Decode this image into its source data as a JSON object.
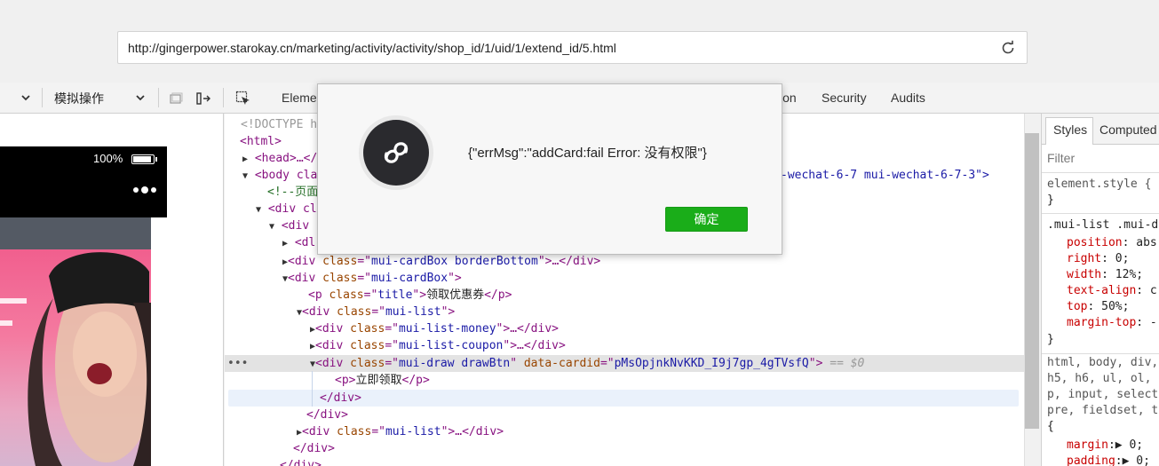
{
  "address_bar": {
    "url": "http://gingerpower.starokay.cn/marketing/activity/activity/shop_id/1/uid/1/extend_id/5.html"
  },
  "devtools": {
    "toolbar": {
      "simulate_label": "模拟操作"
    },
    "tabs": [
      {
        "label": "Eleme"
      },
      {
        "label": "ion"
      },
      {
        "label": "Security"
      },
      {
        "label": "Audits"
      }
    ],
    "styles_panel": {
      "tabs": [
        {
          "label": "Styles"
        },
        {
          "label": "Computed"
        }
      ],
      "filter_placeholder": "Filter",
      "rule1_selector": "element.style {",
      "rule1_close": "}",
      "rule2_selector": ".mui-list .mui-d",
      "rule2_props": [
        {
          "name": "position",
          "value": ": abs"
        },
        {
          "name": "right",
          "value": ": 0;"
        },
        {
          "name": "width",
          "value": ": 12%;"
        },
        {
          "name": "text-align",
          "value": ": c"
        },
        {
          "name": "top",
          "value": ": 50%;"
        },
        {
          "name": "margin-top",
          "value": ": -"
        }
      ],
      "rule2_close": "}",
      "rule3_lines": [
        "html, body, div,",
        "h5, h6, ul, ol,",
        "p, input, select",
        "pre, fieldset, t",
        "{"
      ],
      "rule3_props": [
        {
          "name": "margin",
          "value": ":▶ 0;"
        },
        {
          "name": "padding",
          "value": ":▶ 0;"
        }
      ]
    }
  },
  "phone": {
    "battery": "100%"
  },
  "elements_tree": {
    "doctype": "<!DOCTYPE h",
    "html_open": "<html>",
    "head": "<head>…</",
    "body_prefix": "<body cla",
    "body_suffix": "-wechat-6-7 mui-wechat-6-7-3\">",
    "comment": "<!--页面",
    "div1": "<div cl",
    "div2": "<div",
    "dl": "<dl",
    "cardbox1": {
      "tag_open": "<div ",
      "attr": "class",
      "eq": "=\"",
      "value": "mui-cardBox borderBottom",
      "close": "\">…</div>"
    },
    "cardbox2": {
      "tag_open": "<div ",
      "attr": "class",
      "eq": "=\"",
      "value": "mui-cardBox",
      "close": "\">"
    },
    "p_title": {
      "tag_open": "<p ",
      "attr": "class",
      "eq": "=\"",
      "value": "title",
      "mid": "\">",
      "text": "领取优惠券",
      "close": "</p>"
    },
    "mui_list": {
      "tag_open": "<div ",
      "attr": "class",
      "eq": "=\"",
      "value": "mui-list",
      "close": "\">"
    },
    "money": {
      "tag_open": "<div ",
      "attr": "class",
      "eq": "=\"",
      "value": "mui-list-money",
      "close": "\">…</div>"
    },
    "coupon": {
      "tag_open": "<div ",
      "attr": "class",
      "eq": "=\"",
      "value": "mui-list-coupon",
      "close": "\">…</div>"
    },
    "draw": {
      "tag_open": "<div ",
      "attr": "class",
      "eq": "=\"",
      "value": "mui-draw drawBtn",
      "attr2": " data-cardid",
      "eq2": "=\"",
      "value2": "pMsOpjnkNvKKD_I9j7gp_4gTVsfQ",
      "close": "\">",
      "marker": " == $0"
    },
    "p_draw": {
      "open": "<p>",
      "text": "立即领取",
      "close": "</p>"
    },
    "div_close": "</div>",
    "div_close2": "</div>",
    "mui_list2": {
      "tag_open": "<div ",
      "attr": "class",
      "eq": "=\"",
      "value": "mui-list",
      "close": "\">…</div>"
    },
    "div_close3": "</div>",
    "div_close4": "</div>",
    "ellipsis": "•••"
  },
  "modal": {
    "message": "{\"errMsg\":\"addCard:fail Error: 没有权限\"}",
    "confirm_label": "确定"
  }
}
